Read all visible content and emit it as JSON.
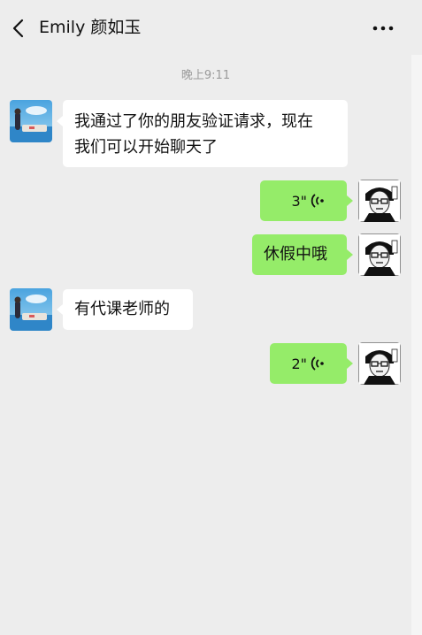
{
  "header": {
    "title": "Emily 颜如玉"
  },
  "timestamp": "晚上9:11",
  "messages": [
    {
      "from": "contact",
      "type": "text",
      "text_line1": "我通过了你的朋友验证请求，现在",
      "text_line2": "我们可以开始聊天了"
    },
    {
      "from": "me",
      "type": "voice",
      "duration": "3\""
    },
    {
      "from": "me",
      "type": "text",
      "text": "休假中哦"
    },
    {
      "from": "contact",
      "type": "text",
      "text": "有代课老师的"
    },
    {
      "from": "me",
      "type": "voice",
      "duration": "2\""
    }
  ],
  "colors": {
    "background": "#ededed",
    "sent_bubble": "#95ec69",
    "received_bubble": "#ffffff"
  },
  "icons": [
    "back-icon",
    "more-icon",
    "voice-wave-icon",
    "avatar-contact",
    "avatar-self"
  ]
}
